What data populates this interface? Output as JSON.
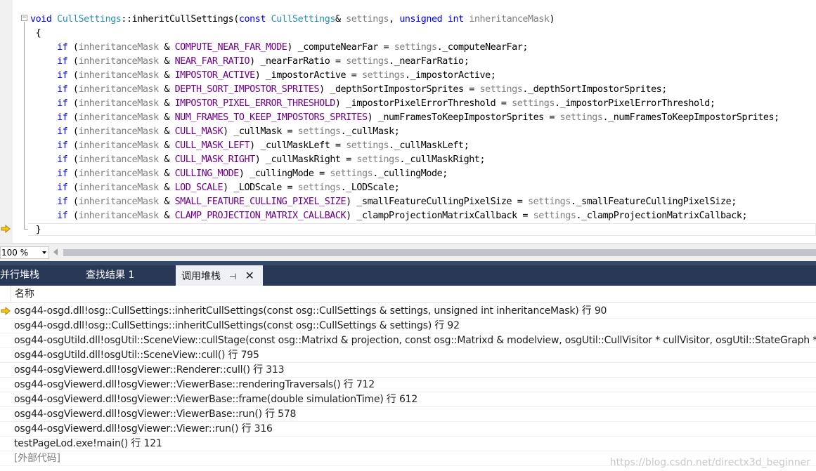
{
  "editor": {
    "signature": {
      "kw_void": "void",
      "class": "CullSettings",
      "sep": "::",
      "fn": "inheritCullSettings(",
      "kw_const": "const",
      "class2": "CullSettings",
      "amp": "& ",
      "p1": "settings",
      "comma": ", ",
      "kw_unsigned": "unsigned",
      "kw_int": "int",
      "p2": "inheritanceMask",
      "close": ")"
    },
    "open_brace": "{",
    "close_brace": "}",
    "if_kw": "if",
    "mask_var": "inheritanceMask",
    "settings_var": "settings",
    "lines": [
      {
        "mask": "COMPUTE_NEAR_FAR_MODE",
        "member": "_computeNearFar"
      },
      {
        "mask": "NEAR_FAR_RATIO",
        "member": "_nearFarRatio"
      },
      {
        "mask": "IMPOSTOR_ACTIVE",
        "member": "_impostorActive"
      },
      {
        "mask": "DEPTH_SORT_IMPOSTOR_SPRITES",
        "member": "_depthSortImpostorSprites"
      },
      {
        "mask": "IMPOSTOR_PIXEL_ERROR_THRESHOLD",
        "member": "_impostorPixelErrorThreshold"
      },
      {
        "mask": "NUM_FRAMES_TO_KEEP_IMPOSTORS_SPRITES",
        "member": "_numFramesToKeepImpostorSprites"
      },
      {
        "mask": "CULL_MASK",
        "member": "_cullMask"
      },
      {
        "mask": "CULL_MASK_LEFT",
        "member": "_cullMaskLeft"
      },
      {
        "mask": "CULL_MASK_RIGHT",
        "member": "_cullMaskRight"
      },
      {
        "mask": "CULLING_MODE",
        "member": "_cullingMode"
      },
      {
        "mask": "LOD_SCALE",
        "member": "_LODScale"
      },
      {
        "mask": "SMALL_FEATURE_CULLING_PIXEL_SIZE",
        "member": "_smallFeatureCullingPixelSize"
      },
      {
        "mask": "CLAMP_PROJECTION_MATRIX_CALLBACK",
        "member": "_clampProjectionMatrixCallback"
      }
    ]
  },
  "zoom": {
    "value": "100 %"
  },
  "tabs": {
    "parallel_stacks": "并行堆栈",
    "find_results": "查找结果 1",
    "call_stack": "调用堆栈",
    "pin_icon": "pin-icon",
    "close_icon": "close-icon"
  },
  "callstack": {
    "column_name": "名称",
    "rows": [
      "osg44-osgd.dll!osg::CullSettings::inheritCullSettings(const osg::CullSettings & settings, unsigned int inheritanceMask) 行 90",
      "osg44-osgd.dll!osg::CullSettings::inheritCullSettings(const osg::CullSettings & settings) 行 92",
      "osg44-osgUtild.dll!osgUtil::SceneView::cullStage(const osg::Matrixd & projection, const osg::Matrixd & modelview, osgUtil::CullVisitor * cullVisitor, osgUtil::StateGraph * rende",
      "osg44-osgUtild.dll!osgUtil::SceneView::cull() 行 795",
      "osg44-osgViewerd.dll!osgViewer::Renderer::cull() 行 313",
      "osg44-osgViewerd.dll!osgViewer::ViewerBase::renderingTraversals() 行 712",
      "osg44-osgViewerd.dll!osgViewer::ViewerBase::frame(double simulationTime) 行 612",
      "osg44-osgViewerd.dll!osgViewer::ViewerBase::run() 行 578",
      "osg44-osgViewerd.dll!osgViewer::Viewer::run() 行 316",
      "testPageLod.exe!main() 行 121"
    ],
    "external_code": "[外部代码]"
  },
  "watermark": "https://blog.csdn.net/directx3d_beginner",
  "colors": {
    "keyword": "#0000ff",
    "type": "#2b91af",
    "param": "#808080",
    "macro": "#6f008a",
    "tab_strip": "#293955",
    "current_arrow": "#f5c518"
  }
}
